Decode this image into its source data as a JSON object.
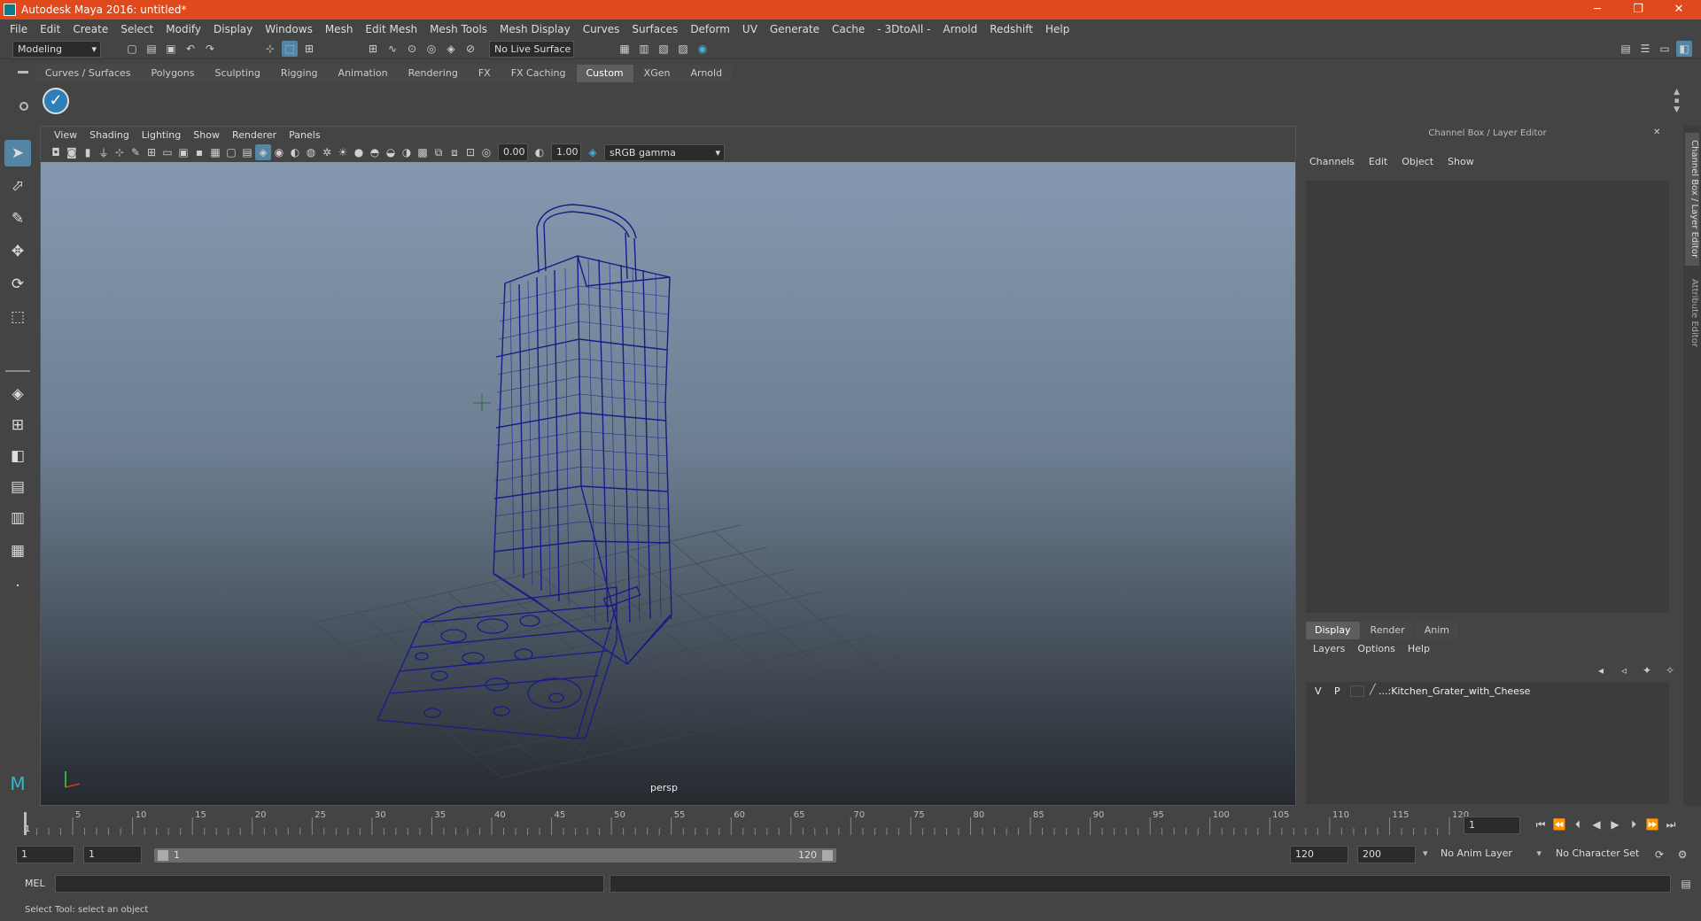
{
  "window": {
    "title": "Autodesk Maya 2016: untitled*",
    "minimize": "─",
    "maximize": "❐",
    "close": "✕"
  },
  "menubar": {
    "items": [
      "File",
      "Edit",
      "Create",
      "Select",
      "Modify",
      "Display",
      "Windows",
      "Mesh",
      "Edit Mesh",
      "Mesh Tools",
      "Mesh Display",
      "Curves",
      "Surfaces",
      "Deform",
      "UV",
      "Generate",
      "Cache",
      "- 3DtoAll -",
      "Arnold",
      "Redshift",
      "Help"
    ]
  },
  "statusline": {
    "mode": "Modeling",
    "live_surface": "No Live Surface"
  },
  "shelf": {
    "tabs": [
      "Curves / Surfaces",
      "Polygons",
      "Sculpting",
      "Rigging",
      "Animation",
      "Rendering",
      "FX",
      "FX Caching",
      "Custom",
      "XGen",
      "Arnold"
    ],
    "active_tab": "Custom"
  },
  "viewport": {
    "menu": [
      "View",
      "Shading",
      "Lighting",
      "Show",
      "Renderer",
      "Panels"
    ],
    "exposure": "0.00",
    "gamma": "1.00",
    "colorspace": "sRGB gamma",
    "camera_label": "persp",
    "wire_color": "#1a1a8a"
  },
  "channelbox": {
    "title": "Channel Box / Layer Editor",
    "menu": [
      "Channels",
      "Edit",
      "Object",
      "Show"
    ],
    "side_tabs": [
      "Channel Box / Layer Editor",
      "Attribute Editor"
    ]
  },
  "layereditor": {
    "tabs": [
      "Display",
      "Render",
      "Anim"
    ],
    "active_tab": "Display",
    "menu": [
      "Layers",
      "Options",
      "Help"
    ],
    "layer": {
      "v": "V",
      "p": "P",
      "name": "...:Kitchen_Grater_with_Cheese"
    }
  },
  "timeline": {
    "ticks": [
      "5",
      "10",
      "15",
      "20",
      "25",
      "30",
      "35",
      "40",
      "45",
      "50",
      "55",
      "60",
      "65",
      "70",
      "75",
      "80",
      "85",
      "90",
      "95",
      "100",
      "105",
      "110",
      "115",
      "120"
    ],
    "start_label": "1",
    "current_frame": "1"
  },
  "rangebar": {
    "start": "1",
    "playback_start": "1",
    "slider_start": "1",
    "slider_end": "120",
    "playback_end": "120",
    "end": "200",
    "anim_layer": "No Anim Layer",
    "char_set": "No Character Set"
  },
  "cmdline": {
    "label": "MEL"
  },
  "helpline": {
    "text": "Select Tool: select an object"
  }
}
